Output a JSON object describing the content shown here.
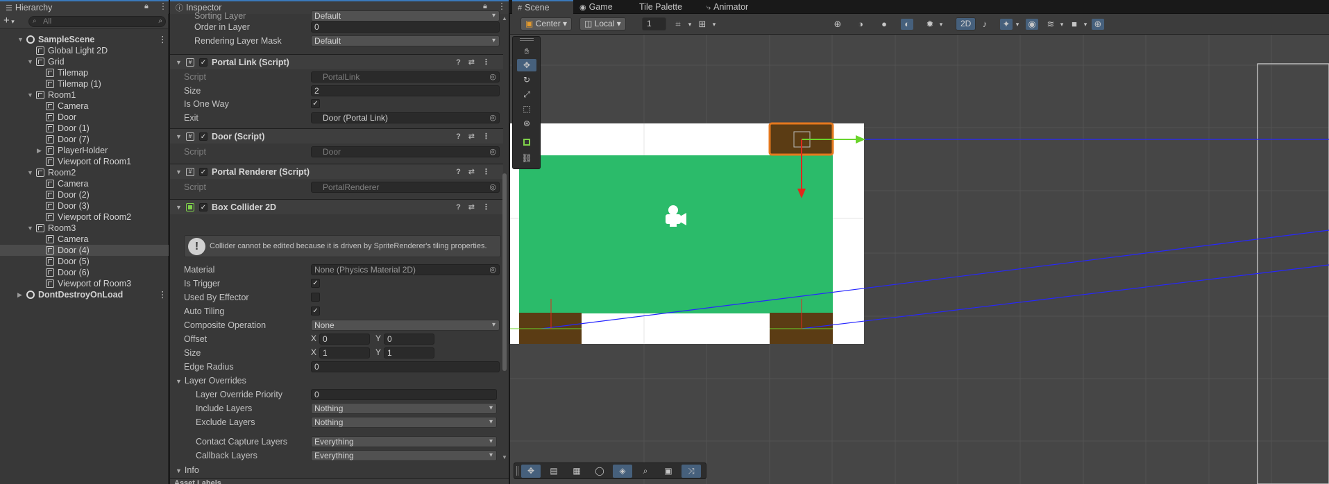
{
  "tabs": {
    "hierarchy": "Hierarchy",
    "inspector": "Inspector",
    "scene": "Scene",
    "game": "Game",
    "tile_palette": "Tile Palette",
    "animator": "Animator"
  },
  "hierarchy": {
    "search_placeholder": "All",
    "items": [
      {
        "label": "SampleScene",
        "depth": 0,
        "kind": "scene",
        "expanded": true
      },
      {
        "label": "Global Light 2D",
        "depth": 1,
        "kind": "object"
      },
      {
        "label": "Grid",
        "depth": 1,
        "kind": "object",
        "expanded": true
      },
      {
        "label": "Tilemap",
        "depth": 2,
        "kind": "object"
      },
      {
        "label": "Tilemap (1)",
        "depth": 2,
        "kind": "object"
      },
      {
        "label": "Room1",
        "depth": 1,
        "kind": "object",
        "expanded": true
      },
      {
        "label": "Camera",
        "depth": 2,
        "kind": "object"
      },
      {
        "label": "Door",
        "depth": 2,
        "kind": "object"
      },
      {
        "label": "Door (1)",
        "depth": 2,
        "kind": "object"
      },
      {
        "label": "Door (7)",
        "depth": 2,
        "kind": "object"
      },
      {
        "label": "PlayerHolder",
        "depth": 2,
        "kind": "object",
        "collapsed": true
      },
      {
        "label": "Viewport of Room1",
        "depth": 2,
        "kind": "object"
      },
      {
        "label": "Room2",
        "depth": 1,
        "kind": "object",
        "expanded": true
      },
      {
        "label": "Camera",
        "depth": 2,
        "kind": "object"
      },
      {
        "label": "Door (2)",
        "depth": 2,
        "kind": "object"
      },
      {
        "label": "Door (3)",
        "depth": 2,
        "kind": "object"
      },
      {
        "label": "Viewport of Room2",
        "depth": 2,
        "kind": "object"
      },
      {
        "label": "Room3",
        "depth": 1,
        "kind": "object",
        "expanded": true
      },
      {
        "label": "Camera",
        "depth": 2,
        "kind": "object"
      },
      {
        "label": "Door (4)",
        "depth": 2,
        "kind": "object",
        "selected": true
      },
      {
        "label": "Door (5)",
        "depth": 2,
        "kind": "object"
      },
      {
        "label": "Door (6)",
        "depth": 2,
        "kind": "object"
      },
      {
        "label": "Viewport of Room3",
        "depth": 2,
        "kind": "object"
      },
      {
        "label": "DontDestroyOnLoad",
        "depth": 0,
        "kind": "scene",
        "collapsed": true
      }
    ]
  },
  "inspector": {
    "sorting_layer_label": "Sorting Layer",
    "sorting_layer_value": "Default",
    "order_in_layer_label": "Order in Layer",
    "order_in_layer_value": "0",
    "rendering_layer_mask_label": "Rendering Layer Mask",
    "rendering_layer_mask_value": "Default",
    "portal_link": {
      "title": "Portal Link (Script)",
      "script_label": "Script",
      "script_value": "PortalLink",
      "size_label": "Size",
      "size_value": "2",
      "one_way_label": "Is One Way",
      "exit_label": "Exit",
      "exit_value": "Door (Portal Link)"
    },
    "door": {
      "title": "Door (Script)",
      "script_label": "Script",
      "script_value": "Door"
    },
    "portal_renderer": {
      "title": "Portal Renderer (Script)",
      "script_label": "Script",
      "script_value": "PortalRenderer"
    },
    "box_collider": {
      "title": "Box Collider 2D",
      "help": "Collider cannot be edited because it is driven by SpriteRenderer's tiling properties.",
      "material_label": "Material",
      "material_value": "None (Physics Material 2D)",
      "is_trigger_label": "Is Trigger",
      "used_by_effector_label": "Used By Effector",
      "auto_tiling_label": "Auto Tiling",
      "composite_label": "Composite Operation",
      "composite_value": "None",
      "offset_label": "Offset",
      "offset_x": "0",
      "offset_y": "0",
      "size_label": "Size",
      "size_x": "1",
      "size_y": "1",
      "axis_x": "X",
      "axis_y": "Y",
      "edge_radius_label": "Edge Radius",
      "edge_radius_value": "0",
      "layer_overrides_label": "Layer Overrides",
      "override_priority_label": "Layer Override Priority",
      "override_priority_value": "0",
      "include_layers_label": "Include Layers",
      "include_layers_value": "Nothing",
      "exclude_layers_label": "Exclude Layers",
      "exclude_layers_value": "Nothing",
      "contact_capture_label": "Contact Capture Layers",
      "contact_capture_value": "Everything",
      "callback_layers_label": "Callback Layers",
      "callback_layers_value": "Everything",
      "info_label": "Info"
    },
    "asset_labels": "Asset Labels"
  },
  "scene_toolbar": {
    "pivot": "Center",
    "space": "Local",
    "grid_size": "1",
    "mode_2d": "2D"
  },
  "colors": {
    "room_fill": "#2bbb6a",
    "door_fill": "#5b3c14",
    "selection": "#e4781e",
    "axis_y": "#e0281c",
    "axis_x": "#6ad42a",
    "portal_line": "#2626ff"
  }
}
